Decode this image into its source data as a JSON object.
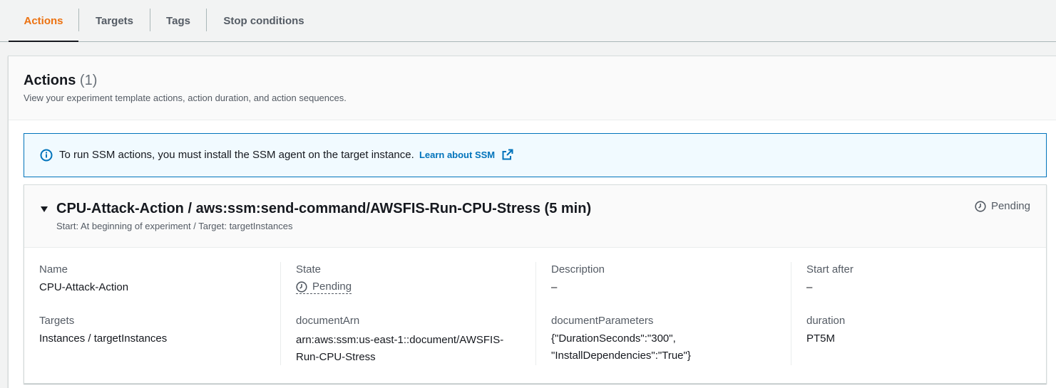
{
  "tabs": [
    {
      "label": "Actions",
      "active": true
    },
    {
      "label": "Targets",
      "active": false
    },
    {
      "label": "Tags",
      "active": false
    },
    {
      "label": "Stop conditions",
      "active": false
    }
  ],
  "section": {
    "title": "Actions",
    "count": "(1)",
    "description": "View your experiment template actions, action duration, and action sequences."
  },
  "alert": {
    "icon": "info-icon",
    "text": "To run SSM actions, you must install the SSM agent on the target instance.",
    "link_label": "Learn about SSM",
    "link_icon": "external-link-icon"
  },
  "action": {
    "title": "CPU-Attack-Action / aws:ssm:send-command/AWSFIS-Run-CPU-Stress (5 min)",
    "subtitle": "Start: At beginning of experiment / Target: targetInstances",
    "status": "Pending",
    "details": {
      "name_label": "Name",
      "name_value": "CPU-Attack-Action",
      "targets_label": "Targets",
      "targets_value": "Instances / targetInstances",
      "state_label": "State",
      "state_value": "Pending",
      "document_arn_label": "documentArn",
      "document_arn_line1": "arn:aws:ssm:us-east-1::document/AWSFIS-",
      "document_arn_line2": "Run-CPU-Stress",
      "description_label": "Description",
      "description_value": "–",
      "document_parameters_label": "documentParameters",
      "document_parameters_line1": "{\"DurationSeconds\":\"300\",",
      "document_parameters_line2": "\"InstallDependencies\":\"True\"}",
      "start_after_label": "Start after",
      "start_after_value": "–",
      "duration_label": "duration",
      "duration_value": "PT5M"
    }
  },
  "colors": {
    "accent": "#ec7211",
    "link": "#0073bb",
    "alert_bg": "#f1faff"
  }
}
